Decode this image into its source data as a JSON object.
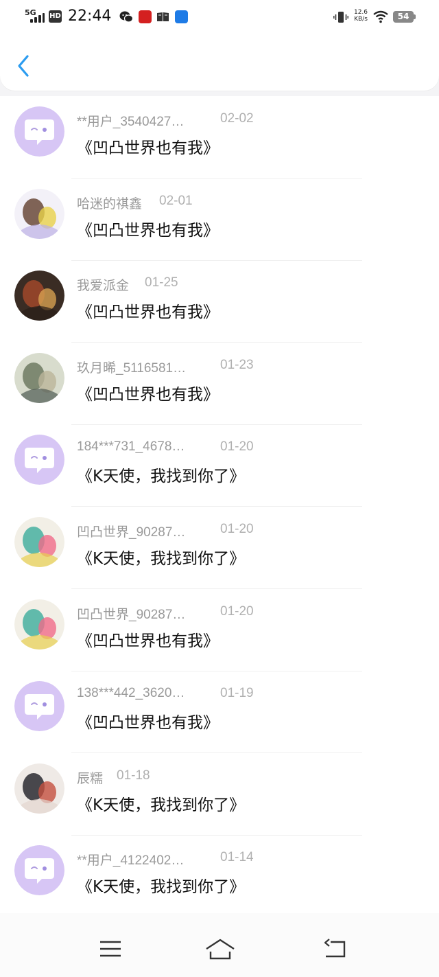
{
  "status_bar": {
    "network_label": "5G",
    "hd_label": "HD",
    "time": "22:44",
    "net_speed_value": "12.6",
    "net_speed_unit": "KB/s",
    "battery": "54",
    "icons": [
      "signal-icon",
      "wechat-icon",
      "app-icon-red",
      "reader-icon",
      "app-icon-blue",
      "vibrate-icon",
      "wifi-icon",
      "battery-icon"
    ]
  },
  "header": {
    "back_icon": "chevron-left-icon",
    "accent_color": "#2b9cf0"
  },
  "items": [
    {
      "user": "**用户_3540427…",
      "date": "02-02",
      "title": "《凹凸世界也有我》",
      "avatar": "default-chat-avatar"
    },
    {
      "user": "哈迷的祺鑫",
      "date": "02-01",
      "title": "《凹凸世界也有我》",
      "avatar": "user-avatar"
    },
    {
      "user": "我爱派金",
      "date": "01-25",
      "title": "《凹凸世界也有我》",
      "avatar": "user-avatar"
    },
    {
      "user": "玖月晞_5116581…",
      "date": "01-23",
      "title": "《凹凸世界也有我》",
      "avatar": "user-avatar"
    },
    {
      "user": "184***731_4678…",
      "date": "01-20",
      "title": "《K天使，我找到你了》",
      "avatar": "default-chat-avatar"
    },
    {
      "user": "凹凸世界_90287…",
      "date": "01-20",
      "title": "《K天使，我找到你了》",
      "avatar": "user-avatar"
    },
    {
      "user": "凹凸世界_90287…",
      "date": "01-20",
      "title": "《凹凸世界也有我》",
      "avatar": "user-avatar"
    },
    {
      "user": "138***442_3620…",
      "date": "01-19",
      "title": "《凹凸世界也有我》",
      "avatar": "default-chat-avatar"
    },
    {
      "user": "辰糯",
      "date": "01-18",
      "title": "《K天使，我找到你了》",
      "avatar": "user-avatar"
    },
    {
      "user": "**用户_4122402…",
      "date": "01-14",
      "title": "《K天使，我找到你了》",
      "avatar": "default-chat-avatar"
    }
  ],
  "nav_bar": {
    "icons": [
      "menu-icon",
      "home-icon",
      "back-nav-icon"
    ]
  }
}
